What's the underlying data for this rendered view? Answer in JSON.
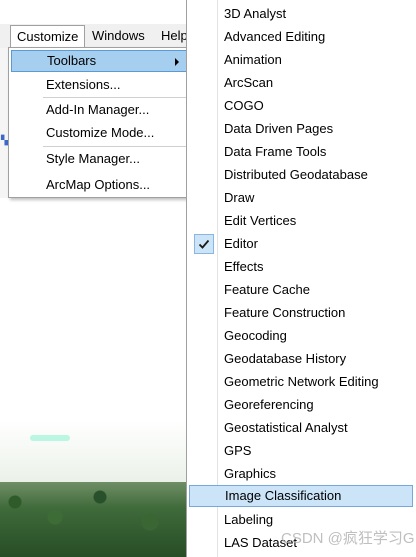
{
  "menubar": {
    "customize": "Customize",
    "windows": "Windows",
    "help": "Help"
  },
  "customize_menu": {
    "items": [
      {
        "label": "Toolbars",
        "has_submenu": true,
        "highlighted": true
      },
      {
        "label": "Extensions..."
      },
      {
        "label": "Add-In Manager..."
      },
      {
        "label": "Customize Mode..."
      },
      {
        "label": "Style Manager..."
      },
      {
        "label": "ArcMap Options..."
      }
    ]
  },
  "toolbars_submenu": {
    "items": [
      {
        "label": "3D Analyst"
      },
      {
        "label": "Advanced Editing"
      },
      {
        "label": "Animation"
      },
      {
        "label": "ArcScan"
      },
      {
        "label": "COGO"
      },
      {
        "label": "Data Driven Pages"
      },
      {
        "label": "Data Frame Tools"
      },
      {
        "label": "Distributed Geodatabase"
      },
      {
        "label": "Draw"
      },
      {
        "label": "Edit Vertices"
      },
      {
        "label": "Editor",
        "checked": true
      },
      {
        "label": "Effects"
      },
      {
        "label": "Feature Cache"
      },
      {
        "label": "Feature Construction"
      },
      {
        "label": "Geocoding"
      },
      {
        "label": "Geodatabase History"
      },
      {
        "label": "Geometric Network Editing"
      },
      {
        "label": "Georeferencing"
      },
      {
        "label": "Geostatistical Analyst"
      },
      {
        "label": "GPS"
      },
      {
        "label": "Graphics"
      },
      {
        "label": "Image Classification",
        "highlighted": true
      },
      {
        "label": "Labeling"
      },
      {
        "label": "LAS Dataset"
      }
    ]
  },
  "watermark": "CSDN @疯狂学习GIS",
  "colors": {
    "highlight": "#a6cfef",
    "hover": "#cce4f7",
    "border": "#a0a0a0"
  }
}
